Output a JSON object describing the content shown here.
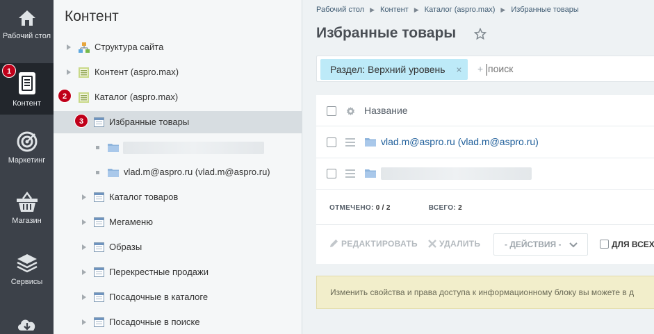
{
  "rail": {
    "items": [
      {
        "label": "Рабочий стол",
        "icon": "home-icon"
      },
      {
        "label": "Контент",
        "icon": "content-icon",
        "active": true,
        "badge": "1"
      },
      {
        "label": "Маркетинг",
        "icon": "target-icon"
      },
      {
        "label": "Магазин",
        "icon": "basket-icon"
      },
      {
        "label": "Сервисы",
        "icon": "layers-icon"
      },
      {
        "label": "",
        "icon": "cloud-download-icon"
      }
    ]
  },
  "tree": {
    "title": "Контент",
    "items": [
      {
        "label": "Структура сайта",
        "icon": "sitemap-icon"
      },
      {
        "label": "Контент (aspro.max)",
        "icon": "iblock-type-icon"
      },
      {
        "label": "Каталог (aspro.max)",
        "icon": "iblock-type-icon",
        "badge": "2"
      },
      {
        "label": "Избранные товары",
        "icon": "iblock-icon",
        "badge": "3",
        "selected": true
      },
      {
        "label": "vlad.m@aspro.ru (vlad.m@aspro.ru)",
        "icon": "folder-icon"
      },
      {
        "label": "Каталог товаров",
        "icon": "iblock-icon"
      },
      {
        "label": "Мегаменю",
        "icon": "iblock-icon"
      },
      {
        "label": "Образы",
        "icon": "iblock-icon"
      },
      {
        "label": "Перекрестные продажи",
        "icon": "iblock-icon"
      },
      {
        "label": "Посадочные в каталоге",
        "icon": "iblock-icon"
      },
      {
        "label": "Посадочные в поиске",
        "icon": "iblock-icon"
      }
    ]
  },
  "breadcrumbs": [
    "Рабочий стол",
    "Контент",
    "Каталог (aspro.max)",
    "Избранные товары"
  ],
  "page_title": "Избранные товары",
  "filter": {
    "chip_label": "Раздел: Верхний уровень",
    "chip_close": "×",
    "plus": "+",
    "placeholder": "поиск"
  },
  "grid": {
    "column_name": "Название",
    "rows": [
      {
        "label": "vlad.m@aspro.ru (vlad.m@aspro.ru)"
      },
      {
        "label": ""
      }
    ],
    "checked_label": "ОТМЕЧЕНО:",
    "checked_value": "0 / 2",
    "total_label": "ВСЕГО:",
    "total_value": "2",
    "edit_label": "РЕДАКТИРОВАТЬ",
    "delete_label": "УДАЛИТЬ",
    "actions_label": "- ДЕЙСТВИЯ -",
    "for_all_label": "ДЛЯ ВСЕХ"
  },
  "notice": "Изменить свойства и права доступа к информационному блоку вы можете в д",
  "colors": {
    "rail_bg": "#3c4149",
    "accent_badge": "#c0001a",
    "chip_bg": "#bdeaf8",
    "link": "#1e5e9a",
    "notice_bg": "#f2eecb"
  }
}
